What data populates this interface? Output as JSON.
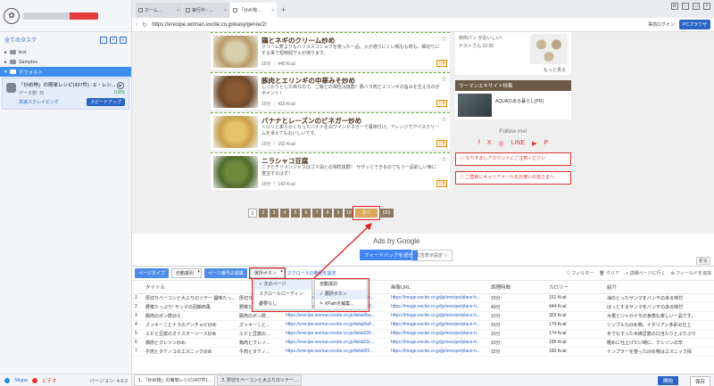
{
  "sidebar": {
    "all_tasks": "全てのタスク",
    "tree": [
      "test",
      "Samples",
      "デフォルト"
    ],
    "task": {
      "title": "「炒め物」の簡単レシピ(437件) - E・レシ...",
      "sub": "データ数: 35",
      "progress": "100%",
      "status": "高速スクレイピング",
      "speedup": "スピードアップ"
    },
    "skype": "Skype",
    "video": "ビデオ",
    "version": "バージョン: 4.0.2"
  },
  "browser": {
    "tabs": [
      "ホーム...",
      "実行中 - ...",
      "「炒め物..."
    ],
    "url": "https://erecipe.woman.excite.co.jp/easy/genre/2/",
    "prelogin": "事前ログイン",
    "pc_browser": "PCブラウザ"
  },
  "recipes": [
    {
      "title": "鶏とネギのクリーム炒め",
      "desc": "クリーム煮よりもハリススコショウを使った一品。火が通りにくい鶏もも肉も、細切りにする事で短時間で火が通ります。",
      "meta": "15分 ｜ 440 Kcal",
      "badge": "定番"
    },
    {
      "title": "豚肉とエリンギの中華みそ炒め",
      "desc": "しっかりとした味なので、ご飯との相性は抜群！豚バラ肉とエリンギの旨みを生えるのがポイント！",
      "meta": "15分 ｜ 410 Kcal",
      "badge": "定番"
    },
    {
      "title": "バナナとレーズンのビネガー炒め",
      "desc": "トロリと柔らかくなったバナナを白ワインビネガーで風味付け。アレンジでアイスクリームを添えてもおいしいです。",
      "meta": "15分 ｜ 152 Kcal",
      "badge": "定番"
    },
    {
      "title": "ニラシャコ豆腐",
      "desc": "ニラとチリメンジャコはゴマ油との相性抜群！ サザッとできるのでもう一品欲しい時に重宝するはず！",
      "meta": "15分 ｜ 143 Kcal",
      "badge": "定番"
    }
  ],
  "pager": {
    "pages": [
      "1",
      "2",
      "3",
      "4",
      "5",
      "6",
      "7",
      "8",
      "9",
      "10"
    ],
    "next": "次へ",
    "last": "[30]"
  },
  "aside": {
    "ad_text": "秋田パン がおいしい！",
    "ad_sub": "ゲストさん 12:39",
    "more": "もっと見る",
    "feature_title": "ウーマンエキサイト特集",
    "feature_text": "AQUAのある暮らし[PR]",
    "follow": "Follow me!",
    "socials": [
      "f",
      "X",
      "◎",
      "LINE",
      "▶",
      "P"
    ],
    "warn1": "なりすましアカウントにご注意ください",
    "warn2": "ご登録にキャリアメールをお使いの皆さまへ"
  },
  "ads": {
    "label": "Ads by Google",
    "feedback": "フィードバックを送信",
    "settings": "広告表示設定 ⓘ",
    "shrink": "折る"
  },
  "toolbar": {
    "page_type": "ページタイプ",
    "auto_detect": "自動識別",
    "page_num": "ページ番号の認識",
    "select_btn": "選択ボタン",
    "scroll_link": "スクロールの範囲を設定",
    "filter": "フィルター",
    "clear": "クリア",
    "detail": "詳細ページに行く",
    "add_field": "フィールドを追加"
  },
  "dropdown1": [
    "次のページ",
    "スクロールローディング",
    "必要なし"
  ],
  "dropdown2": [
    "自動識別",
    "選択ボタン",
    "XPathを編集..."
  ],
  "table": {
    "headers": [
      "",
      "タイトル",
      "",
      "URL",
      "画像URL",
      "調理時間",
      "カロリー",
      "紹介"
    ],
    "rows": [
      [
        "1",
        "厚切りベーコンと大ぶりのソテー 醤味たっ...",
        "厚切りベーコ...",
        "https://erecipe.woman.excite.co.jp/detail/bc...",
        "https://image.excite.co.jp/jp/erecipe/place-h...",
        "15分",
        "151 Kcal",
        "油のとったサンマをバンチのある味付"
      ],
      [
        "2",
        "野菜たっぷり! サンマの回鍋肉風",
        "野菜たっぷり...",
        "https://erecipe.woman.excite.co.jp/detail/58...",
        "https://image.excite.co.jp/jp/erecipe/place-h...",
        "40分",
        "444 Kcal",
        "ほっとするサンマをバンチのある味付"
      ],
      [
        "3",
        "豚肉のポン酢炒え",
        "豚肉のポン酢...",
        "https://erecipe.woman.excite.co.jp/detail/ba...",
        "https://image.excite.co.jp/jp/erecipe/place-h...",
        "10分",
        "303 Kcal",
        "大根とジャガイモの食感も楽しい一品です。"
      ],
      [
        "4",
        "ズッキーニとナスのアンチョビ炒め",
        "ズッキーニと...",
        "https://erecipe.woman.excite.co.jp/detail/a8...",
        "https://image.excite.co.jp/jp/erecipe/place-h...",
        "15分",
        "174 Kcal",
        "シンプルな炒め物。イタリアン多彩の仕上"
      ],
      [
        "5",
        "エビと豆腐のオイスターソース炒め",
        "エビと豆腐の...",
        "https://erecipe.woman.excite.co.jp/detail/39...",
        "https://image.excite.co.jp/jp/erecipe/place-h...",
        "15分",
        "174 Kcal",
        "手でもすった木綿豆腐の口当たりとぷりぷり"
      ],
      [
        "6",
        "鶏肉とクレソン炒め",
        "鶏肉とクレソ...",
        "https://erecipe.woman.excite.co.jp/detail/3c...",
        "https://image.excite.co.jp/jp/erecipe/place-h...",
        "15分",
        "185 Kcal",
        "軽めに仕上げたい時に、クレソンの辛"
      ],
      [
        "7",
        "牛肉とタケノコのエスニック炒め",
        "牛肉とタケノ...",
        "https://erecipe.woman.excite.co.jp/detail/f3...",
        "https://image.excite.co.jp/jp/erecipe/place-h...",
        "15分",
        "183 Kcal",
        "ナンプラーを使った炒め物はエスニック探"
      ]
    ]
  },
  "bottom": {
    "tab1": "1. 「炒め物」の簡単レシピ(437件)...",
    "tab2": "2. 厚切りベーコンと大ぶりのソテー...",
    "start": "開始",
    "save": "保存"
  }
}
